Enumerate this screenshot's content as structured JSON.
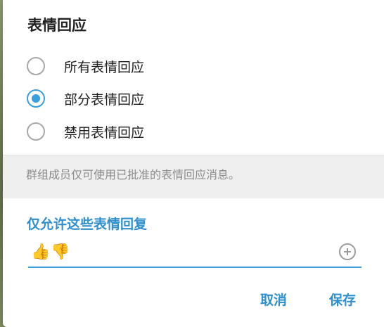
{
  "dialog": {
    "title": "表情回应",
    "options": [
      {
        "label": "所有表情回应",
        "checked": false
      },
      {
        "label": "部分表情回应",
        "checked": true
      },
      {
        "label": "禁用表情回应",
        "checked": false
      }
    ],
    "info_text": "群组成员仅可使用已批准的表情回应消息。",
    "section_heading": "仅允许这些表情回复",
    "emojis": [
      "👍",
      "👎"
    ],
    "add_icon": "add-circle-icon",
    "cancel_label": "取消",
    "save_label": "保存",
    "accent_color": "#3a9fdc"
  }
}
